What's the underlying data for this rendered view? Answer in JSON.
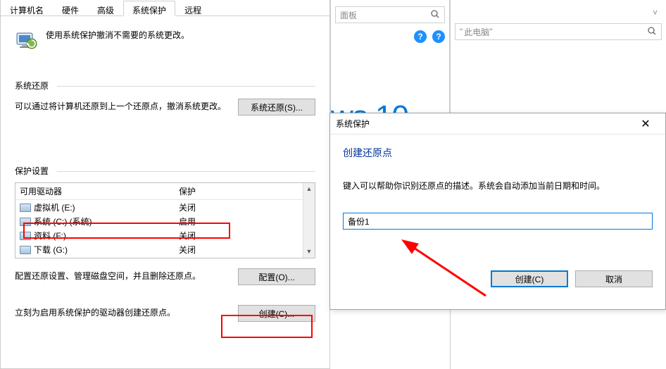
{
  "tabs": {
    "computer_name": "计算机名",
    "hardware": "硬件",
    "advanced": "高级",
    "system_protection": "系统保护",
    "remote": "远程"
  },
  "header_text": "使用系统保护撤消不需要的系统更改。",
  "restore": {
    "title": "系统还原",
    "desc": "可以通过将计算机还原到上一个还原点，撤消系统更改。",
    "button": "系统还原(S)..."
  },
  "protection": {
    "title": "保护设置",
    "col_drive": "可用驱动器",
    "col_status": "保护",
    "rows": [
      {
        "name": "虚拟机 (E:)",
        "status": "关闭"
      },
      {
        "name": "系统 (C:) (系统)",
        "status": "启用"
      },
      {
        "name": "资料 (F:)",
        "status": "关闭"
      },
      {
        "name": "下载 (G:)",
        "status": "关闭"
      }
    ],
    "configure_desc": "配置还原设置、管理磁盘空间，并且删除还原点。",
    "configure_btn": "配置(O)...",
    "create_desc": "立刻为启用系统保护的驱动器创建还原点。",
    "create_btn": "创建(C)..."
  },
  "bg": {
    "panel_search_placeholder": "面板",
    "pc_search_placeholder": "此电脑",
    "win10_text": "ws 10"
  },
  "modal": {
    "title": "系统保护",
    "heading": "创建还原点",
    "desc": "键入可以帮助你识别还原点的描述。系统会自动添加当前日期和时间。",
    "input_value": "备份1",
    "create_btn": "创建(C)",
    "cancel_btn": "取消"
  }
}
